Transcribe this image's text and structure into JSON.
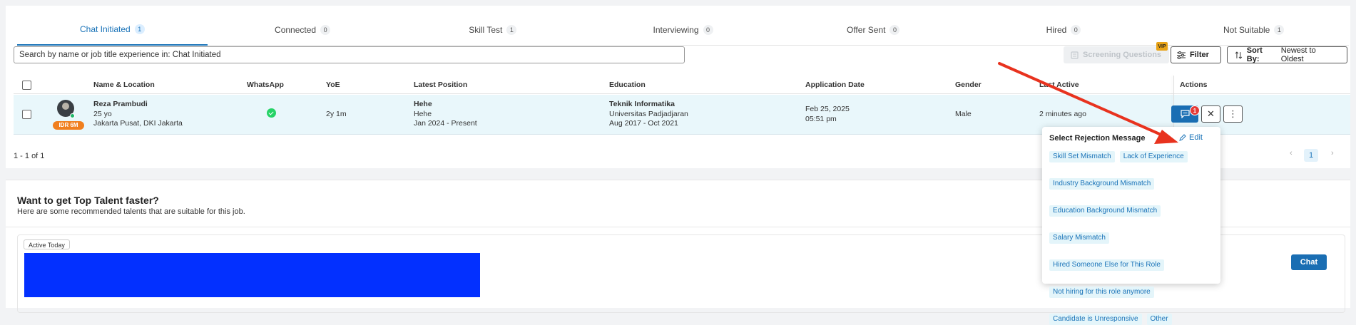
{
  "tabs": [
    {
      "label": "Chat Initiated",
      "count": "1"
    },
    {
      "label": "Connected",
      "count": "0"
    },
    {
      "label": "Skill Test",
      "count": "1"
    },
    {
      "label": "Interviewing",
      "count": "0"
    },
    {
      "label": "Offer Sent",
      "count": "0"
    },
    {
      "label": "Hired",
      "count": "0"
    },
    {
      "label": "Not Suitable",
      "count": "1"
    }
  ],
  "search": {
    "placeholder": "Search by name or job title experience in: Chat Initiated"
  },
  "toolbar": {
    "screening_label": "Screening Questions",
    "vip_label": "VIP",
    "filter_label": "Filter",
    "sort_prefix": "Sort By:",
    "sort_value": "Newest to Oldest"
  },
  "columns": {
    "name": "Name & Location",
    "whatsapp": "WhatsApp",
    "yoe": "YoE",
    "position": "Latest Position",
    "education": "Education",
    "date": "Application Date",
    "gender": "Gender",
    "last_active": "Last Active",
    "actions": "Actions"
  },
  "candidate": {
    "name": "Reza Prambudi",
    "age": "25 yo",
    "location": "Jakarta Pusat, DKI Jakarta",
    "salary_badge": "IDR 6M",
    "yoe": "2y 1m",
    "position_title": "Hehe",
    "position_company": "Hehe",
    "position_period": "Jan 2024 - Present",
    "education_major": "Teknik Informatika",
    "education_school": "Universitas Padjadjaran",
    "education_period": "Aug 2017 - Oct 2021",
    "app_date": "Feb 25, 2025",
    "app_time": "05:51 pm",
    "gender": "Male",
    "last_active": "2 minutes ago",
    "unread": "1"
  },
  "footer": {
    "range": "1 - 1 of 1",
    "page": "1"
  },
  "recommend": {
    "title": "Want to get Top Talent faster?",
    "subtitle": "Here are some recommended talents that are suitable for this job.",
    "active_badge": "Active Today",
    "chat_label": "Chat"
  },
  "rejection": {
    "title": "Select Rejection Message",
    "edit_label": "Edit",
    "options": [
      "Skill Set Mismatch",
      "Lack of Experience",
      "Industry Background Mismatch",
      "Education Background Mismatch",
      "Salary Mismatch",
      "Hired Someone Else for This Role",
      "Not hiring for this role anymore",
      "Candidate is Unresponsive",
      "Other"
    ]
  },
  "colors": {
    "primary": "#1a6eb3",
    "accent_orange": "#f07f1e",
    "arrow": "#e8321e",
    "chip_bg": "#e4f5fa"
  }
}
